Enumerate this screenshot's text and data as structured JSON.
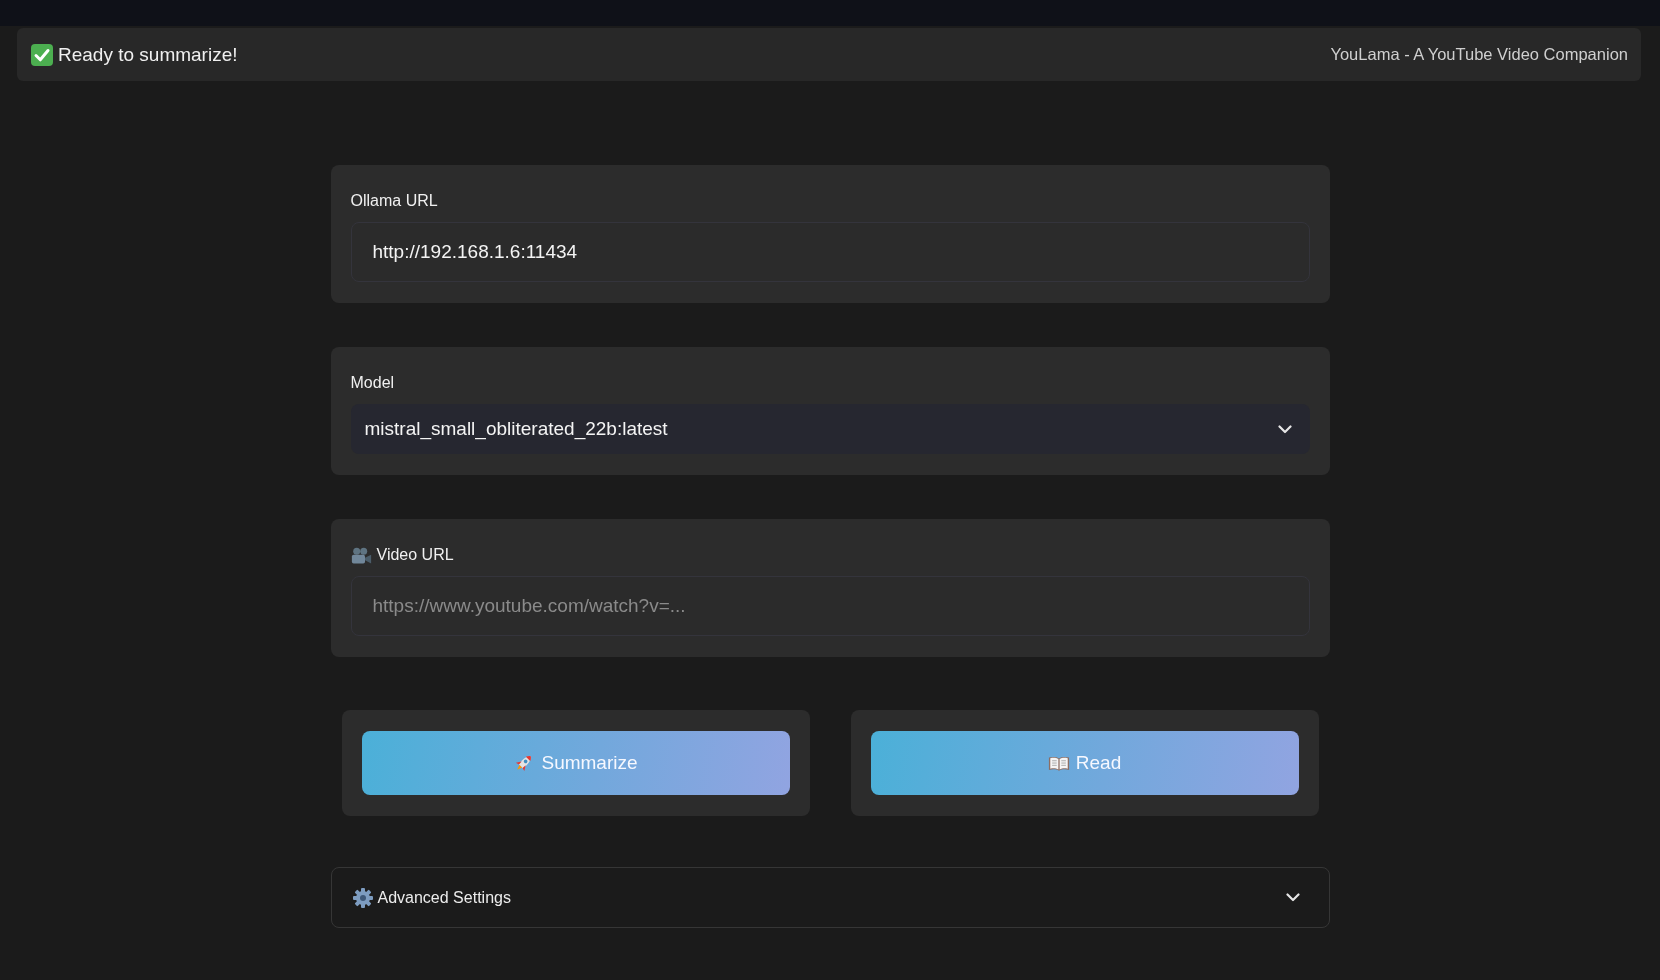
{
  "header": {
    "status": "Ready to summarize!",
    "title": "YouLama - A YouTube Video Companion"
  },
  "fields": [
    {
      "kind": "text",
      "label": "Ollama URL",
      "value": "http://192.168.1.6:11434"
    },
    {
      "kind": "select",
      "label": "Model",
      "value": "mistral_small_obliterated_22b:latest"
    },
    {
      "kind": "text",
      "label": "Video URL",
      "placeholder": "https://www.youtube.com/watch?v=..."
    }
  ],
  "actions": [
    {
      "label": "Summarize"
    },
    {
      "label": "Read"
    }
  ],
  "advanced": {
    "label": "Advanced Settings",
    "expanded": false
  }
}
